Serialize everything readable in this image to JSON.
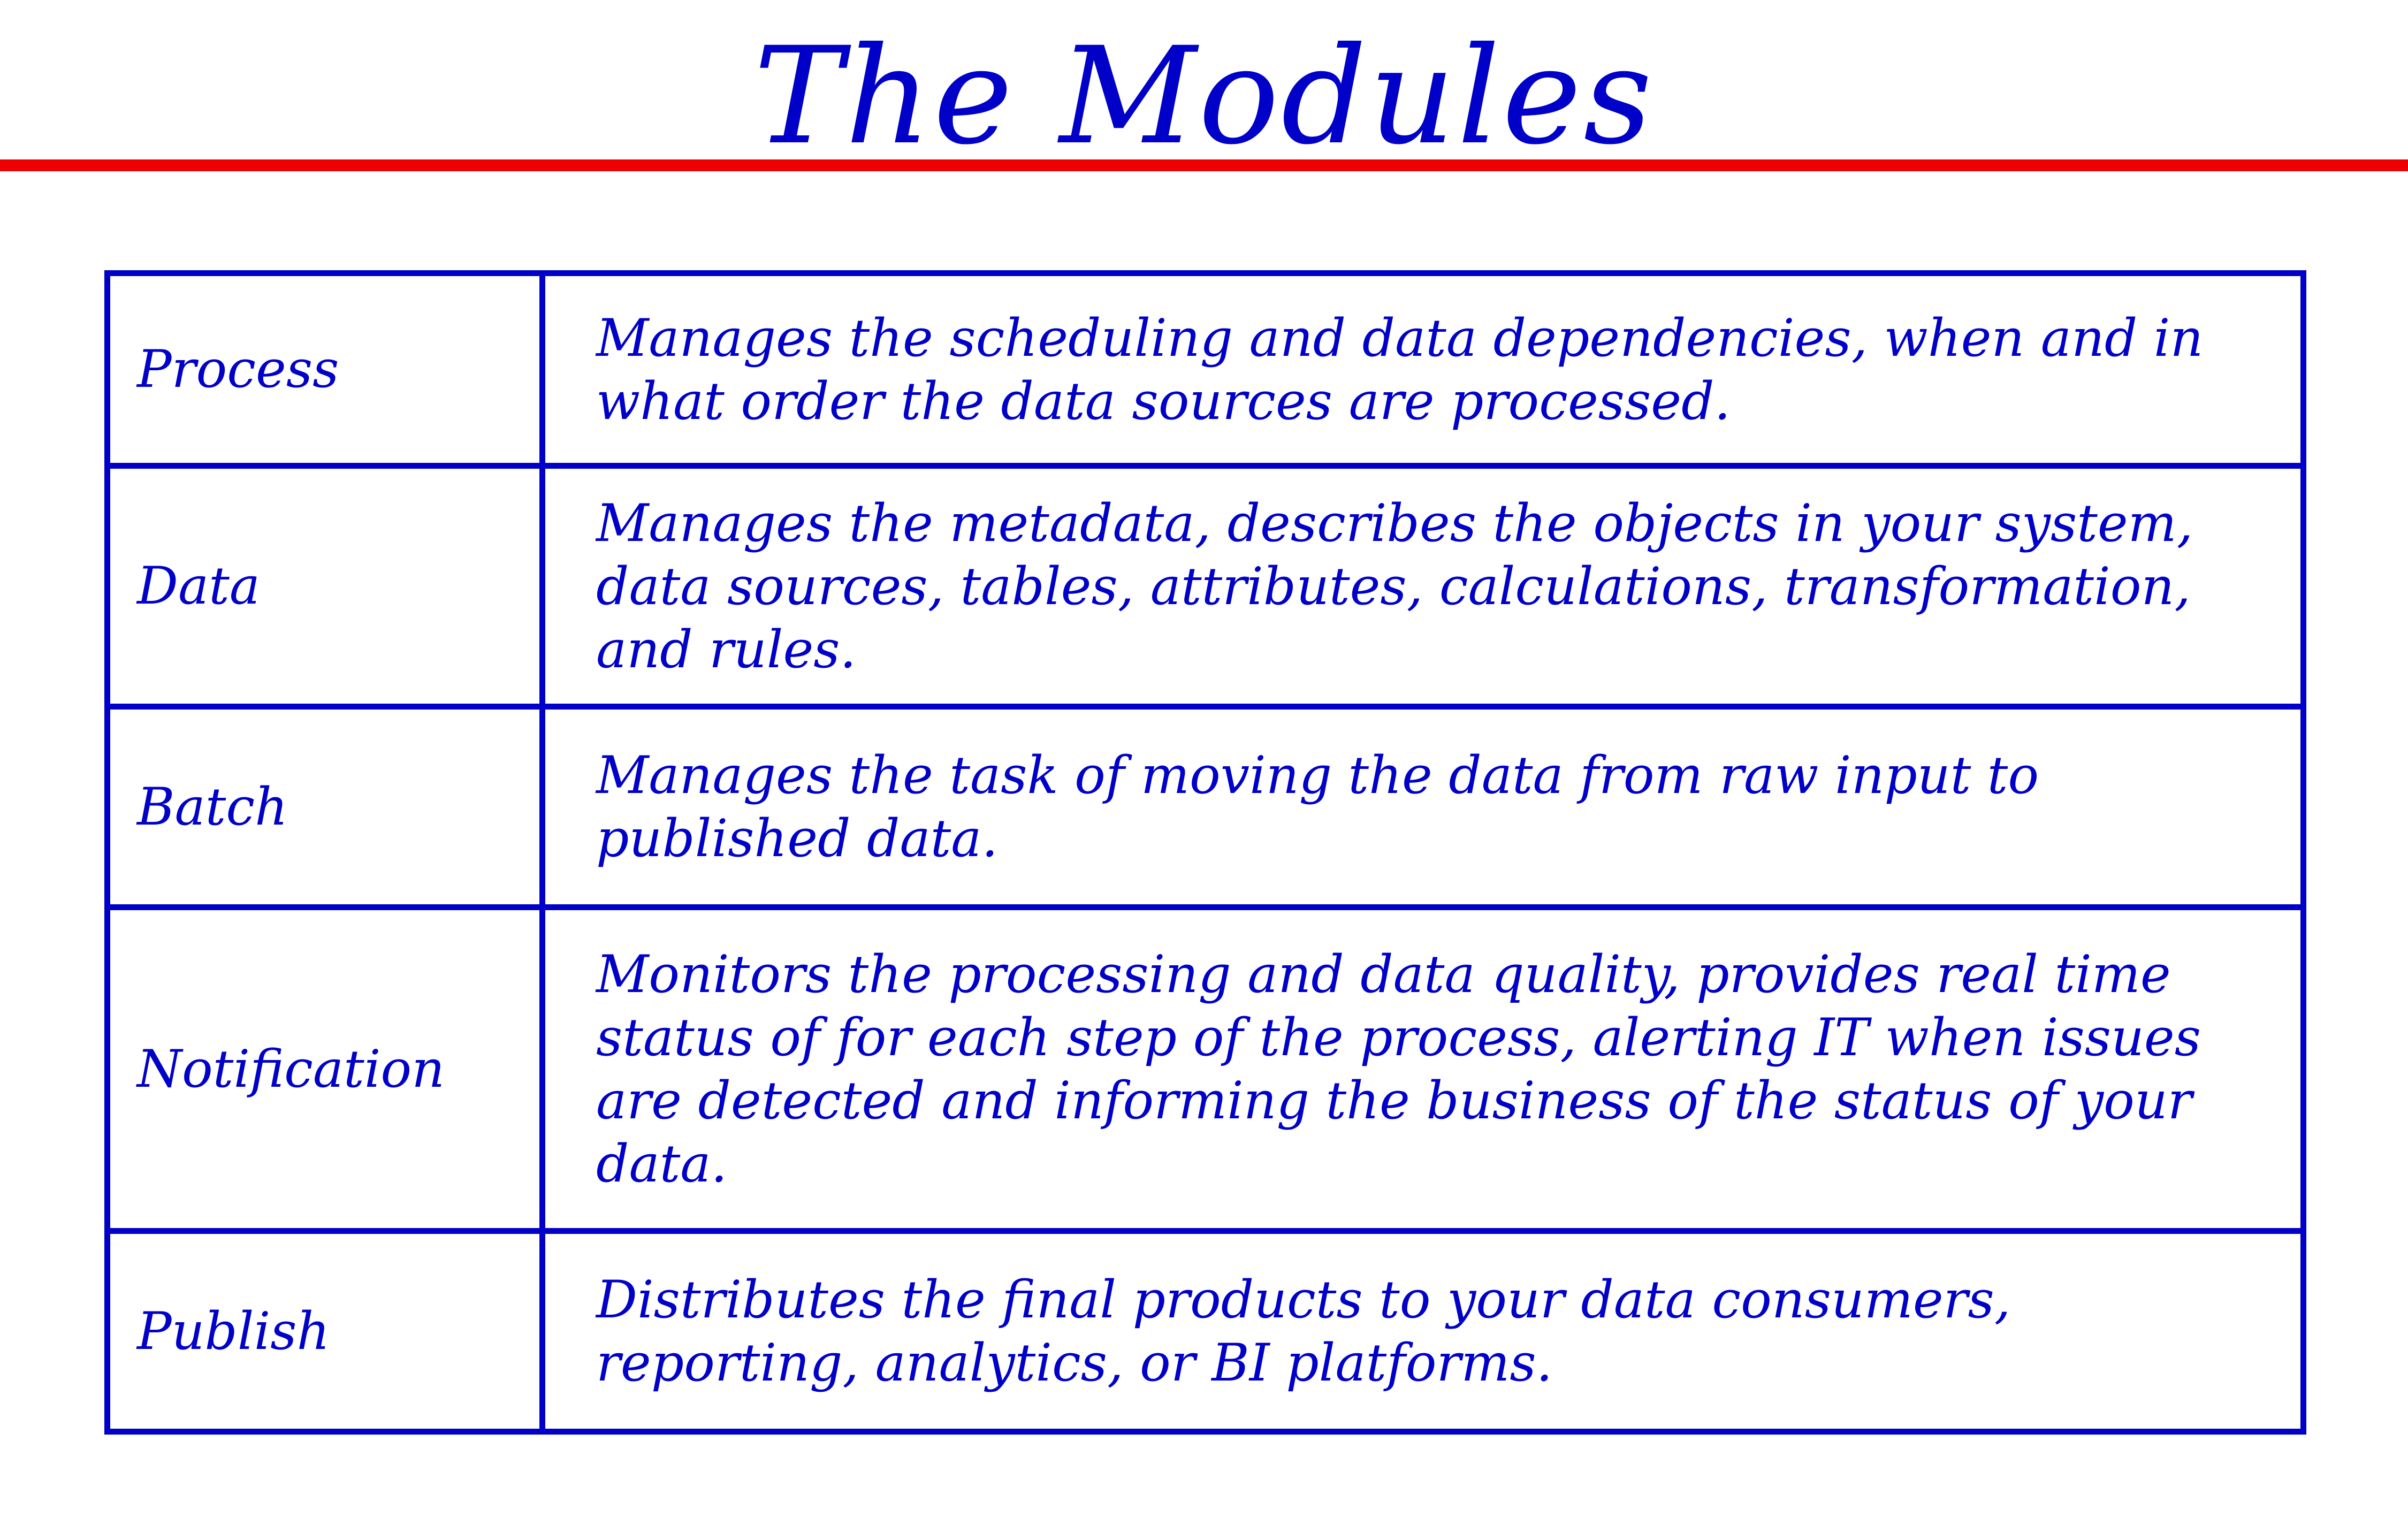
{
  "slide": {
    "title": "The Modules"
  },
  "colors": {
    "text": "#0000c8",
    "rule": "#ee0000",
    "border": "#0000c8",
    "background": "#ffffff"
  },
  "modules": [
    {
      "name": "Process",
      "description": "Manages the scheduling and data dependencies, when and in what order the data sources are processed."
    },
    {
      "name": "Data",
      "description": "Manages the metadata, describes the objects in your system, data sources, tables, attributes, calculations, transformation, and rules."
    },
    {
      "name": "Batch",
      "description": "Manages the task of moving the data from raw input to published data."
    },
    {
      "name": "Notification",
      "description": "Monitors the processing and data quality, provides real time status of for each step of the process, alerting IT when issues are detected and informing the business of the status of your data."
    },
    {
      "name": "Publish",
      "description": "Distributes the final products to your data consumers, reporting, analytics, or BI platforms."
    }
  ]
}
